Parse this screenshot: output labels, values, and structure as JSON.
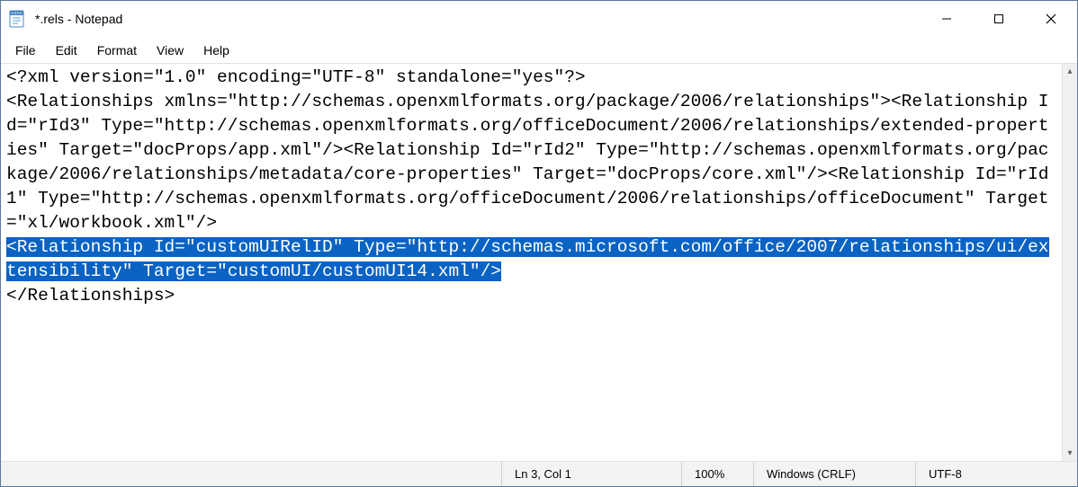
{
  "titlebar": {
    "title": "*.rels - Notepad",
    "minimize_label": "Minimize",
    "maximize_label": "Maximize",
    "close_label": "Close"
  },
  "menu": {
    "file": "File",
    "edit": "Edit",
    "format": "Format",
    "view": "View",
    "help": "Help"
  },
  "content": {
    "pre_selection": "<?xml version=\"1.0\" encoding=\"UTF-8\" standalone=\"yes\"?>\n<Relationships xmlns=\"http://schemas.openxmlformats.org/package/2006/relationships\"><Relationship Id=\"rId3\" Type=\"http://schemas.openxmlformats.org/officeDocument/2006/relationships/extended-properties\" Target=\"docProps/app.xml\"/><Relationship Id=\"rId2\" Type=\"http://schemas.openxmlformats.org/package/2006/relationships/metadata/core-properties\" Target=\"docProps/core.xml\"/><Relationship Id=\"rId1\" Type=\"http://schemas.openxmlformats.org/officeDocument/2006/relationships/officeDocument\" Target=\"xl/workbook.xml\"/>\n",
    "selection": "<Relationship Id=\"customUIRelID\" Type=\"http://schemas.microsoft.com/office/2007/relationships/ui/extensibility\" Target=\"customUI/customUI14.xml\"/>",
    "post_selection": "\n</Relationships>"
  },
  "statusbar": {
    "position": "Ln 3, Col 1",
    "zoom": "100%",
    "line_ending": "Windows (CRLF)",
    "encoding": "UTF-8"
  }
}
